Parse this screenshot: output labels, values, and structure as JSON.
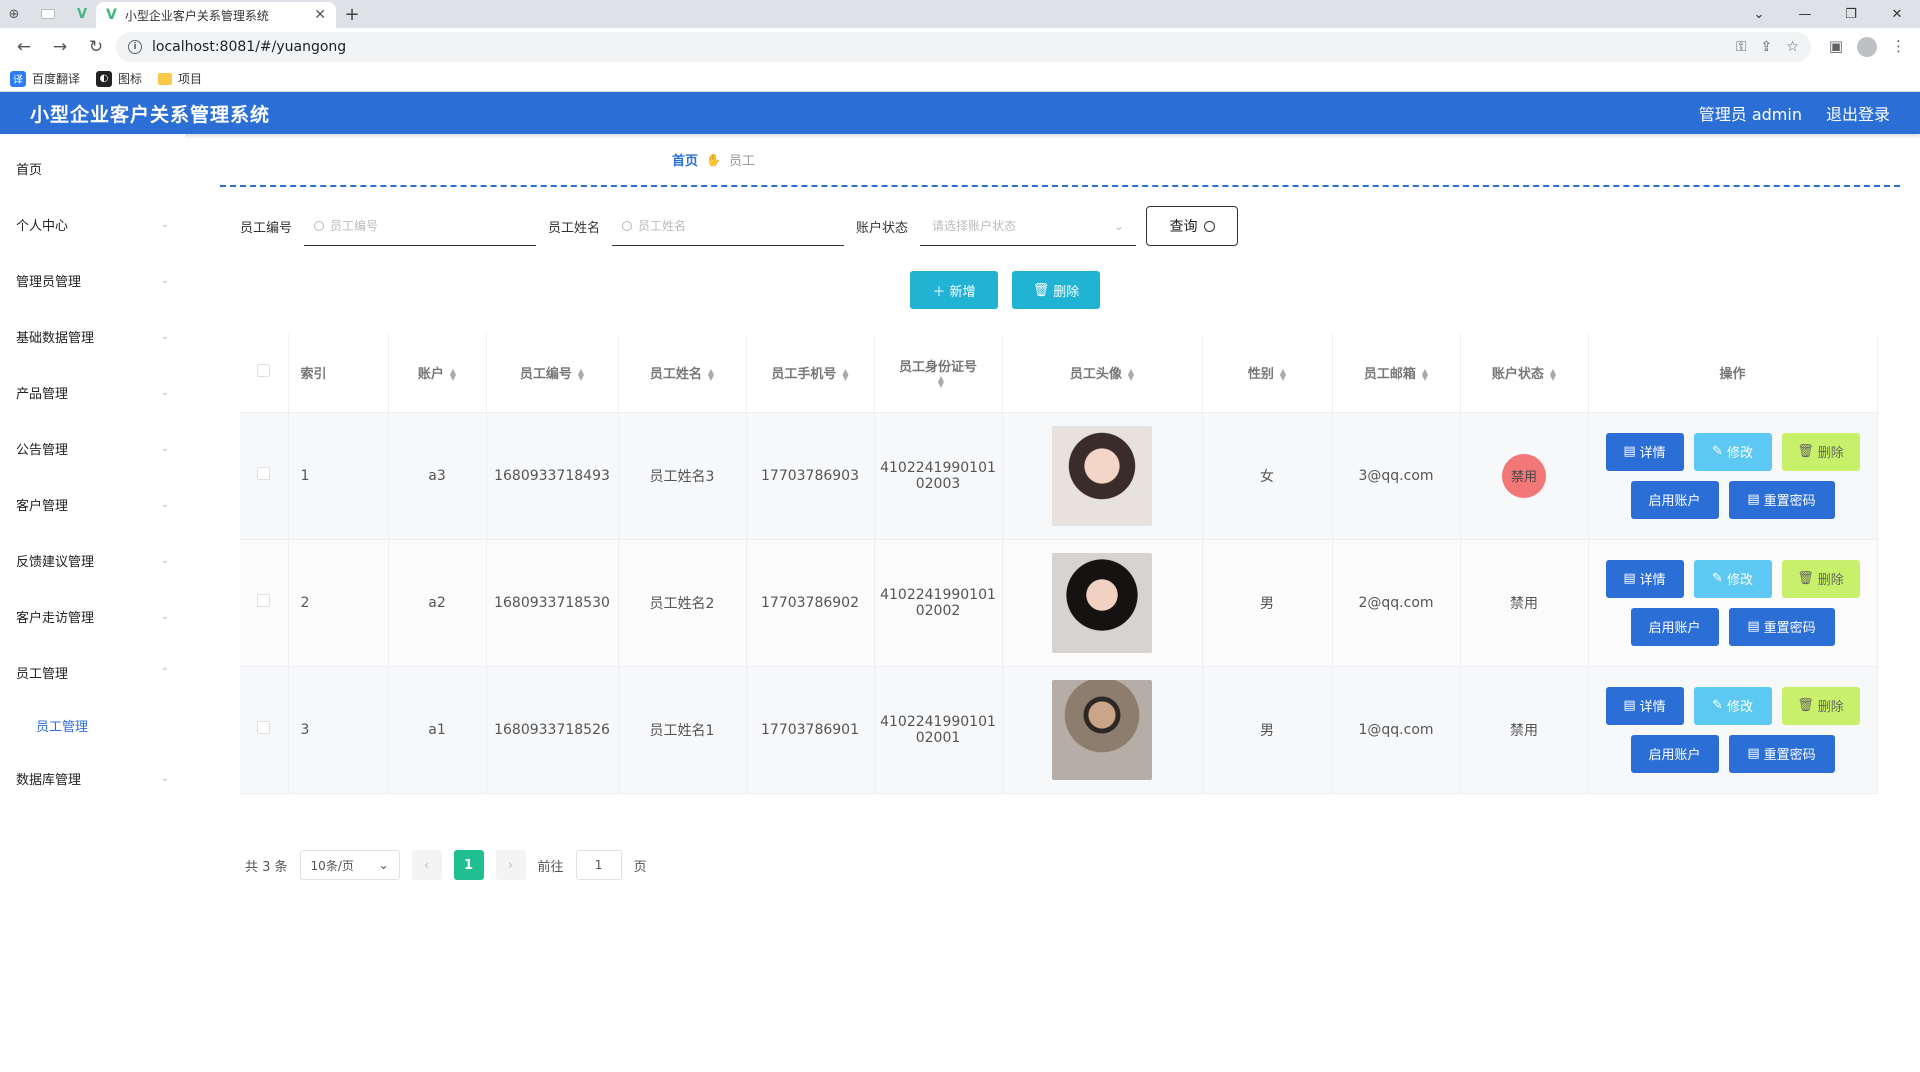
{
  "browser": {
    "tab_title": "小型企业客户关系管理系统",
    "url": "localhost:8081/#/yuangong",
    "bookmarks": [
      "百度翻译",
      "图标",
      "项目"
    ]
  },
  "header": {
    "title": "小型企业客户关系管理系统",
    "user_label": "管理员 admin",
    "logout_label": "退出登录",
    "color": "#2b6fd6"
  },
  "sidebar": {
    "items": [
      {
        "label": "首页"
      },
      {
        "label": "个人中心"
      },
      {
        "label": "管理员管理"
      },
      {
        "label": "基础数据管理"
      },
      {
        "label": "产品管理"
      },
      {
        "label": "公告管理"
      },
      {
        "label": "客户管理"
      },
      {
        "label": "反馈建议管理"
      },
      {
        "label": "客户走访管理"
      },
      {
        "label": "员工管理"
      }
    ],
    "sub_item": "员工管理",
    "last_item": "数据库管理"
  },
  "breadcrumb": {
    "home": "首页",
    "current": "员工"
  },
  "search": {
    "emp_no_label": "员工编号",
    "emp_no_placeholder": "员工编号",
    "emp_name_label": "员工姓名",
    "emp_name_placeholder": "员工姓名",
    "status_label": "账户状态",
    "status_placeholder": "请选择账户状态",
    "query_label": "查询"
  },
  "actions": {
    "add_label": "新增",
    "delete_label": "删除"
  },
  "table": {
    "headers": [
      "索引",
      "账户",
      "员工编号",
      "员工姓名",
      "员工手机号",
      "员工身份证号",
      "员工头像",
      "性别",
      "员工邮箱",
      "账户状态",
      "操作"
    ],
    "rows": [
      {
        "index": "1",
        "account": "a3",
        "emp_no": "1680933718493",
        "name": "员工姓名3",
        "phone": "17703786903",
        "id_card_1": "4102241990101",
        "id_card_2": "02003",
        "gender": "女",
        "email": "3@qq.com",
        "status": "禁用"
      },
      {
        "index": "2",
        "account": "a2",
        "emp_no": "1680933718530",
        "name": "员工姓名2",
        "phone": "17703786902",
        "id_card_1": "4102241990101",
        "id_card_2": "02002",
        "gender": "男",
        "email": "2@qq.com",
        "status": "禁用"
      },
      {
        "index": "3",
        "account": "a1",
        "emp_no": "1680933718526",
        "name": "员工姓名1",
        "phone": "17703786901",
        "id_card_1": "4102241990101",
        "id_card_2": "02001",
        "gender": "男",
        "email": "1@qq.com",
        "status": "禁用"
      }
    ],
    "op_labels": {
      "detail": "详情",
      "edit": "修改",
      "delete": "删除",
      "enable": "启用账户",
      "reset": "重置密码"
    }
  },
  "pagination": {
    "total_label": "共 3 条",
    "page_size": "10条/页",
    "current_page": "1",
    "goto_prefix": "前往",
    "goto_value": "1",
    "goto_suffix": "页"
  }
}
